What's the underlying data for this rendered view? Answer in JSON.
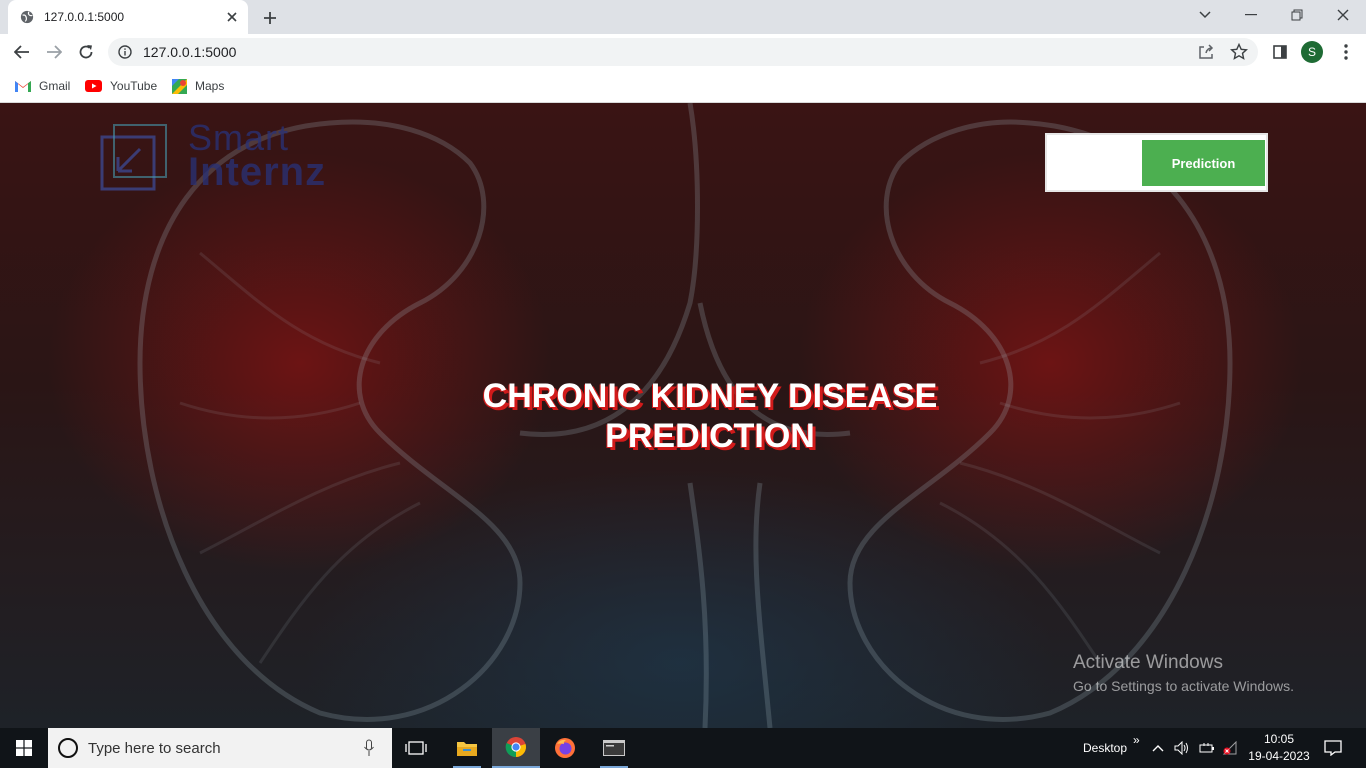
{
  "browser": {
    "tab": {
      "title": "127.0.0.1:5000",
      "favicon": "globe-icon"
    },
    "address_bar": {
      "url": "127.0.0.1:5000"
    },
    "profile_initial": "S",
    "bookmarks": [
      {
        "label": "Gmail",
        "icon": "gmail-icon"
      },
      {
        "label": "YouTube",
        "icon": "youtube-icon"
      },
      {
        "label": "Maps",
        "icon": "maps-icon"
      }
    ]
  },
  "page": {
    "logo": {
      "line1": "Smart",
      "line2": "Internz"
    },
    "nav": {
      "prediction_label": "Prediction",
      "button_color": "#4caf50"
    },
    "headline": {
      "line1": "CHRONIC KIDNEY DISEASE",
      "line2": "PREDICTION",
      "shadow_color": "#d11a1a"
    },
    "watermark": {
      "title": "Activate Windows",
      "subtitle": "Go to Settings to activate Windows."
    }
  },
  "taskbar": {
    "search_placeholder": "Type here to search",
    "desktop_label": "Desktop",
    "time": "10:05",
    "date": "19-04-2023"
  }
}
